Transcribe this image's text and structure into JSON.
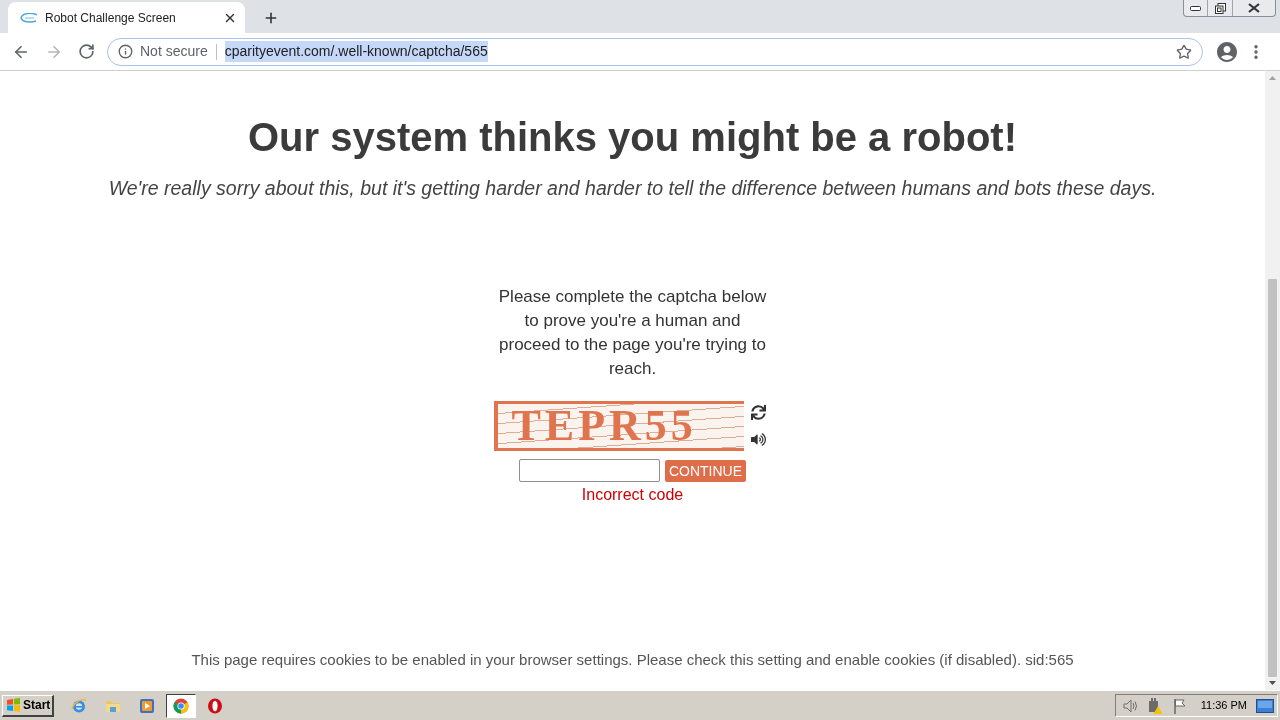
{
  "browser": {
    "tabs": [
      {
        "title": "Robot Challenge Screen",
        "selected": true
      }
    ],
    "navigation": {
      "back": {
        "disabled": false
      },
      "forward": {
        "disabled": true
      }
    },
    "address_bar": {
      "focused": true,
      "security_label": "Not secure",
      "url": "cparityevent.com/.well-known/captcha/565",
      "url_selected": true
    }
  },
  "page": {
    "heading": "Our system thinks you might be a robot!",
    "subheading": "We're really sorry about this, but it's getting harder and harder to tell the difference between humans and bots these days.",
    "instructions": "Please complete the captcha below to prove you're a human and proceed to the page you're trying to reach.",
    "captcha": {
      "image_text": "TEPR55"
    },
    "continue_button": "CONTINUE",
    "error": "Incorrect code",
    "footer": "This page requires cookies to be enabled in your browser settings. Please check this setting and enable cookies (if disabled). sid:565"
  },
  "taskbar": {
    "start": "Start",
    "items": [
      {
        "kind": "e",
        "selected": false
      },
      {
        "kind": "folder",
        "selected": false
      },
      {
        "kind": "play",
        "selected": false
      },
      {
        "kind": "wheel",
        "selected": true
      },
      {
        "kind": "o",
        "selected": false
      }
    ],
    "clock": "11:36 PM"
  }
}
